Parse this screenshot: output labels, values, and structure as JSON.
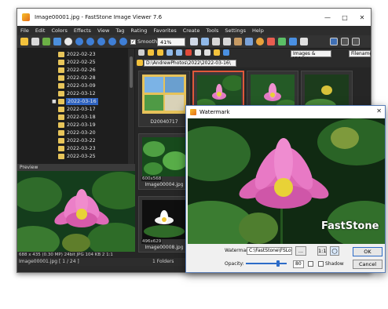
{
  "window": {
    "title": "Image00001.jpg - FastStone Image Viewer 7.6"
  },
  "menu": [
    "File",
    "Edit",
    "Colors",
    "Effects",
    "View",
    "Tag",
    "Rating",
    "Favorites",
    "Create",
    "Tools",
    "Settings",
    "Help"
  ],
  "toolbar": {
    "smooth_label": "Smooth",
    "smooth_checked": true,
    "zoom_value": "41%"
  },
  "browser": {
    "filter_value": "Images & Videos",
    "sort_value": "Filename",
    "path": "D:\\AndrewPhotos\\2022\\2022-03-16\\"
  },
  "tree": {
    "items": [
      "2022-02-23",
      "2022-02-25",
      "2022-02-26",
      "2022-02-28",
      "2022-03-09",
      "2022-03-12",
      "2022-03-16",
      "2022-03-17",
      "2022-03-18",
      "2022-03-19",
      "2022-03-20",
      "2022-03-22",
      "2022-03-23",
      "2022-03-25"
    ],
    "selected": "2022-03-16"
  },
  "preview": {
    "label": "Preview",
    "info": "688 x 435 (0.30 MP)  24bit  JPG   104 KB   2 1:1",
    "filename": "Image00001.jpg [ 1 / 24 ]",
    "folders": "1 Folders"
  },
  "thumbnails": [
    {
      "caption": "D20040717",
      "dims": ""
    },
    {
      "caption": "",
      "dims": ""
    },
    {
      "caption": "",
      "dims": ""
    },
    {
      "caption": "",
      "dims": ""
    },
    {
      "caption": "Image00004.jpg",
      "dims": "600x568"
    },
    {
      "caption": "Image00008.jpg",
      "dims": "496x629"
    }
  ],
  "dialog": {
    "title": "Watermark",
    "watermark_label": "Watermark Image:",
    "watermark_value": "C:\\FastStone\\FSLogo...",
    "browse_label": "...",
    "ratio_label": "1:1",
    "opacity_label": "Opacity:",
    "opacity_value": "80",
    "shadow_label": "Shadow",
    "ok_label": "OK",
    "cancel_label": "Cancel",
    "watermark_text": "FastStone"
  }
}
